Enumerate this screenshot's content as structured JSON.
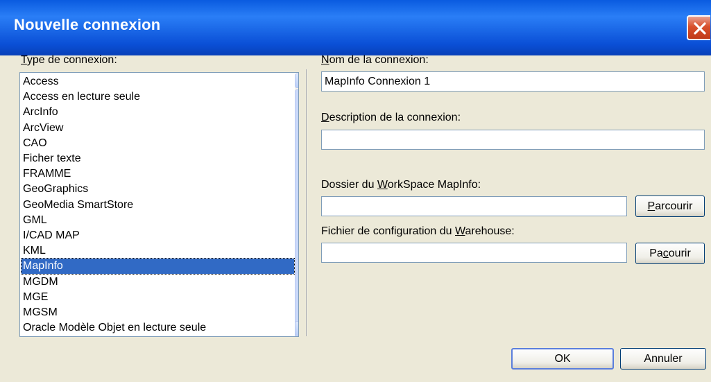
{
  "dialog": {
    "title": "Nouvelle connexion",
    "close_icon": "close-icon"
  },
  "type_label": {
    "first": "T",
    "rest": "ype de connexion:"
  },
  "types": [
    "Access",
    "Access en lecture seule",
    "ArcInfo",
    "ArcView",
    "CAO",
    "Ficher texte",
    "FRAMME",
    "GeoGraphics",
    "GeoMedia SmartStore",
    "GML",
    "I/CAD MAP",
    "KML",
    "MapInfo",
    "MGDM",
    "MGE",
    "MGSM",
    "Oracle Modèle Objet en lecture seule"
  ],
  "selected_type": "MapInfo",
  "name_label": {
    "first": "N",
    "rest": "om de la connexion:"
  },
  "name_value": "MapInfo Connexion 1",
  "desc_label": {
    "first": "D",
    "rest": "escription de la connexion:"
  },
  "desc_value": "",
  "workspace_label": {
    "pre": "Dossier du ",
    "key": "W",
    "post": "orkSpace MapInfo:"
  },
  "workspace_value": "",
  "browse1": {
    "key": "P",
    "rest": "arcourir"
  },
  "warehouse_label": {
    "pre": "Fichier de configuration du ",
    "key": "W",
    "post": "arehouse:"
  },
  "warehouse_value": "",
  "browse2": {
    "pre": "Pa",
    "key": "c",
    "post": "ourir"
  },
  "ok_label": "OK",
  "cancel_label": "Annuler"
}
